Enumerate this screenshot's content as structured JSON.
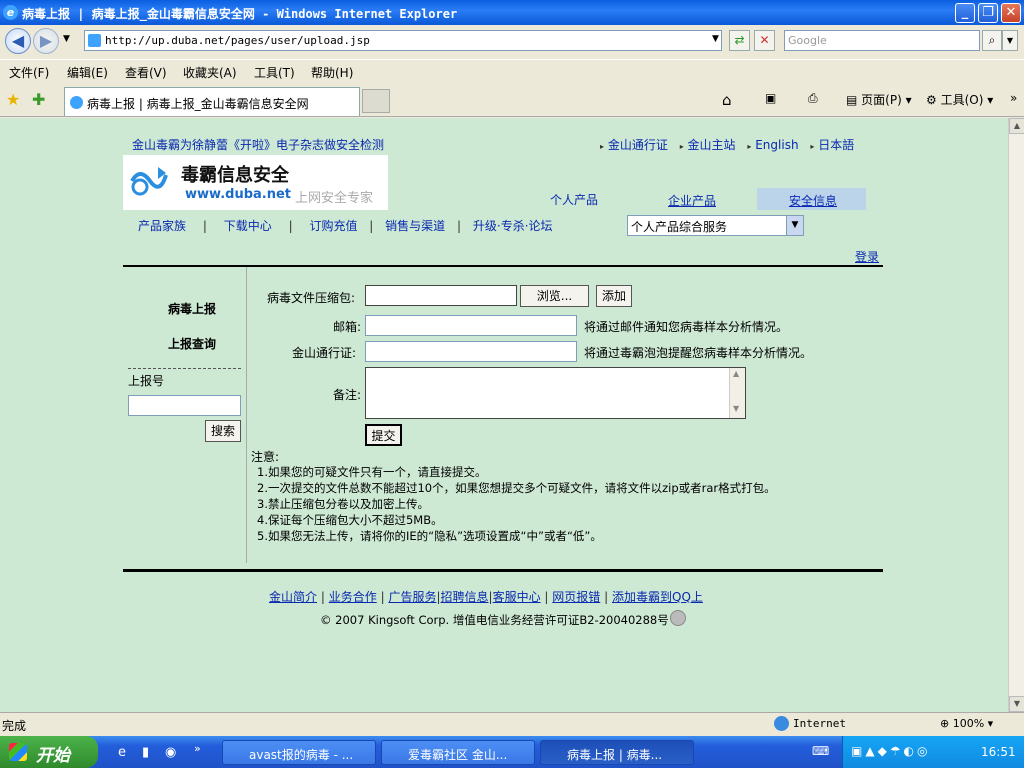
{
  "window": {
    "title": "病毒上报 | 病毒上报_金山毒霸信息安全网 - Windows Internet Explorer"
  },
  "address_bar": {
    "url": "http://up.duba.net/pages/user/upload.jsp",
    "search_placeholder": "Google"
  },
  "menu": [
    "文件(F)",
    "编辑(E)",
    "查看(V)",
    "收藏夹(A)",
    "工具(T)",
    "帮助(H)"
  ],
  "tab": {
    "label": "病毒上报 | 病毒上报_金山毒霸信息安全网"
  },
  "toolbar": {
    "page_label": "页面(P)",
    "tools_label": "工具(O)"
  },
  "site": {
    "promo": "金山毒霸为徐静蕾《开啦》电子杂志做安全检测",
    "top_links": [
      "金山通行证",
      "金山主站",
      "English",
      "日本語"
    ],
    "logo_cn": "毒霸信息安全",
    "logo_url": "www.duba.net",
    "logo_slogan": "上网安全专家",
    "main_tabs": [
      "个人产品",
      "企业产品",
      "安全信息"
    ],
    "nav": [
      "产品家族",
      "下载中心",
      "订购充值",
      "销售与渠道",
      "升级·专杀·论坛"
    ],
    "service_select": "个人产品综合服务",
    "login": "登录"
  },
  "sidebar": {
    "report": "病毒上报",
    "query": "上报查询",
    "number_label": "上报号",
    "search_btn": "搜索"
  },
  "form": {
    "file_label": "病毒文件压缩包:",
    "browse_btn": "浏览...",
    "add_btn": "添加",
    "email_label": "邮箱:",
    "email_hint": "将通过邮件通知您病毒样本分析情况。",
    "passport_label": "金山通行证:",
    "passport_hint": "将通过毒霸泡泡提醒您病毒样本分析情况。",
    "remark_label": "备注:",
    "submit_btn": "提交"
  },
  "notes": {
    "title": "注意:",
    "items": [
      "1.如果您的可疑文件只有一个，请直接提交。",
      "2.一次提交的文件总数不能超过10个，如果您想提交多个可疑文件，请将文件以zip或者rar格式打包。",
      "3.禁止压缩包分卷以及加密上传。",
      "4.保证每个压缩包大小不超过5MB。",
      "5.如果您无法上传，请将你的IE的“隐私”选项设置成“中”或者“低”。"
    ]
  },
  "footer": {
    "links": [
      "金山简介",
      "业务合作",
      "广告服务",
      "招聘信息",
      "客服中心",
      "网页报错",
      "添加毒霸到QQ上"
    ],
    "copyright": "© 2007 Kingsoft Corp. 增值电信业务经营许可证B2-20040288号"
  },
  "status": {
    "left": "完成",
    "zone": "Internet",
    "zoom": "100%"
  },
  "taskbar": {
    "start": "开始",
    "tasks": [
      "avast报的病毒 - ...",
      "爱毒霸社区 金山...",
      "病毒上报 | 病毒..."
    ],
    "clock": "16:51"
  },
  "colors": {
    "page_bg": "#cde8d3",
    "link": "#0a29b0",
    "title_bar": "#0a5fe0",
    "active_tab_bg": "#bcd4ea"
  }
}
